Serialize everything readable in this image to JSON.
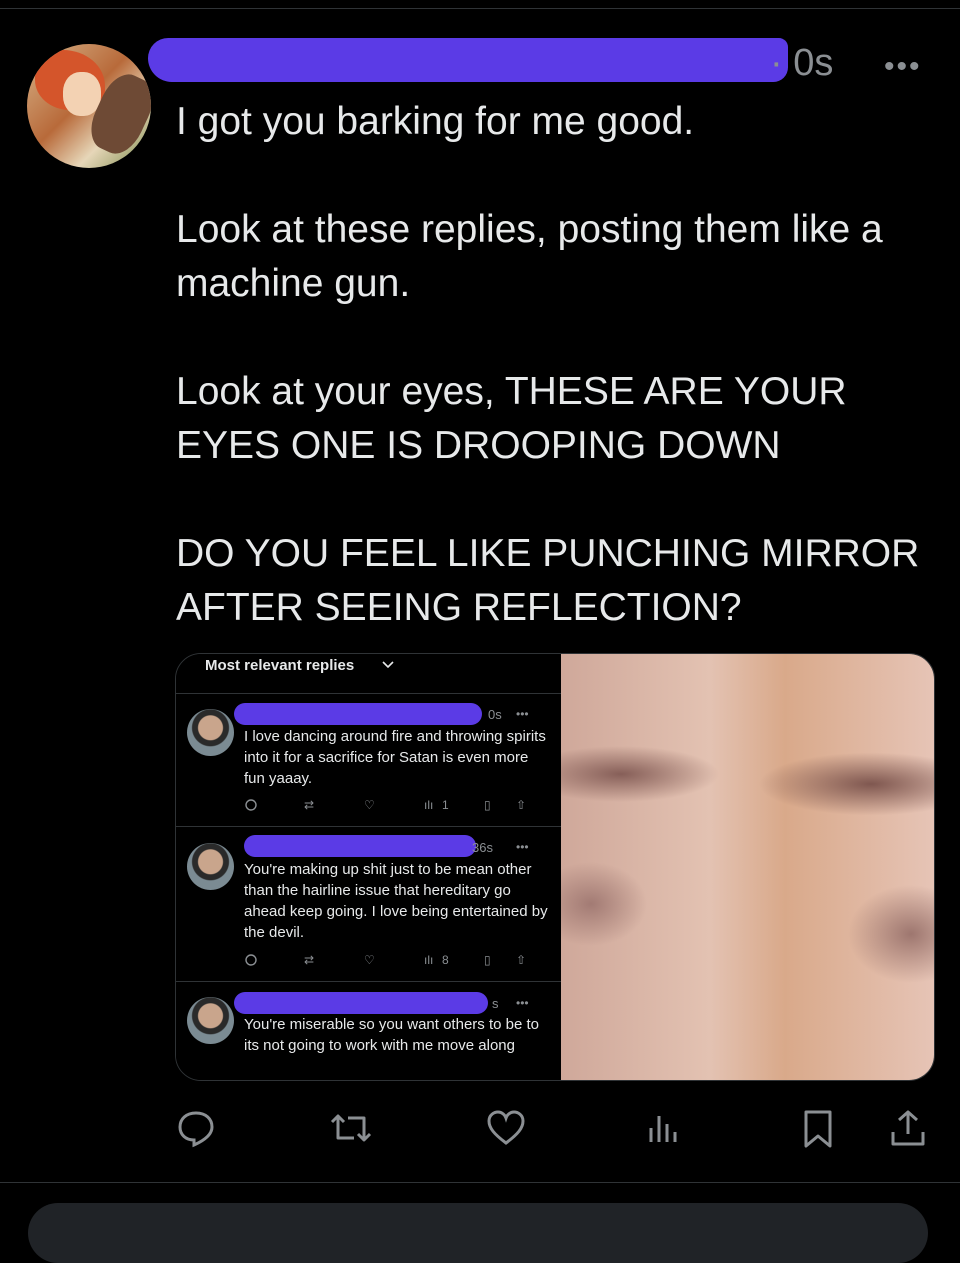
{
  "post": {
    "time": "· 0s",
    "more": "•••",
    "paragraphs": [
      "I got you barking for me good.",
      "Look at these replies, posting them like a machine gun.",
      "Look at your eyes, THESE ARE YOUR EYES ONE IS DROOPING DOWN",
      "DO YOU FEEL LIKE PUNCHING MIRROR AFTER SEEING REFLECTION?"
    ]
  },
  "screenshot": {
    "header": "Most relevant replies",
    "replies": [
      {
        "time": "0s",
        "text": "I love dancing around fire and throwing spirits into it for a sacrifice for Satan is even more fun yaaay.",
        "views": "1"
      },
      {
        "time": "36s",
        "text": "You're making up shit just to be mean other than the hairline issue that hereditary go ahead keep going. I love being entertained by the devil.",
        "views": "8"
      },
      {
        "time": "s",
        "text": "You're miserable so you want others to be to its not going to work with me move along",
        "views": ""
      }
    ]
  },
  "colors": {
    "background": "#000000",
    "text": "#e7e9ea",
    "muted": "#8b8f93",
    "redaction": "#5b3be6"
  }
}
